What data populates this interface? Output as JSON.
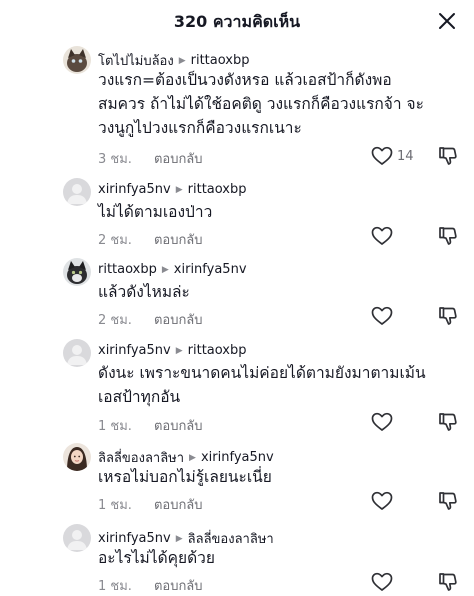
{
  "header": {
    "title": "320 ความคิดเห็น"
  },
  "comments": [
    {
      "user": "โตไปไม่บล้อง",
      "reply_to": "rittaoxbp",
      "lines": [
        "วงแรก=ต้องเป็นวงดังหรอ แล้วเอสป้าก็ดังพอ",
        "สมควร ถ้าไม่ได้ใช้อคติดู วงแรกก็คือวงแรกจ้า จะ",
        "วงนูกูไปวงแรกก็คือวงแรกเนาะ"
      ],
      "time": "3 ชม.",
      "reply_label": "ตอบกลับ",
      "likes": "14",
      "avatar_icon": "cat-photo-icon"
    },
    {
      "user": "xirinfya5nv",
      "reply_to": "rittaoxbp",
      "lines": [
        "ไม่ได้ตามเองป่าว"
      ],
      "time": "2 ชม.",
      "reply_label": "ตอบกลับ",
      "likes": "",
      "avatar_icon": "default-avatar-icon"
    },
    {
      "user": "rittaoxbp",
      "reply_to": "xirinfya5nv",
      "lines": [
        "แล้วดังไหมล่ะ"
      ],
      "time": "2 ชม.",
      "reply_label": "ตอบกลับ",
      "likes": "",
      "avatar_icon": "cat-photo-icon"
    },
    {
      "user": "xirinfya5nv",
      "reply_to": "rittaoxbp",
      "lines": [
        "ดังนะ เพราะขนาดคนไม่ค่อยได้ตามยังมาตามเม้น",
        "เอสป้าทุกอัน"
      ],
      "time": "1 ชม.",
      "reply_label": "ตอบกลับ",
      "likes": "",
      "avatar_icon": "default-avatar-icon"
    },
    {
      "user": "ลิลลี่ของลาลิษา",
      "reply_to": "xirinfya5nv",
      "lines": [
        "เหรอไม่บอกไม่รู้เลยนะเนี่ย"
      ],
      "time": "1 ชม.",
      "reply_label": "ตอบกลับ",
      "likes": "",
      "avatar_icon": "person-photo-icon"
    },
    {
      "user": "xirinfya5nv",
      "reply_to": "ลิลลี่ของลาลิษา",
      "lines": [
        "อะไรไม่ได้คุยด้วย"
      ],
      "time": "1 ชม.",
      "reply_label": "ตอบกลับ",
      "likes": "",
      "avatar_icon": "default-avatar-icon"
    }
  ],
  "colors": {
    "text": "#161823",
    "muted": "#8a8b91",
    "icon": "#2f3035"
  }
}
